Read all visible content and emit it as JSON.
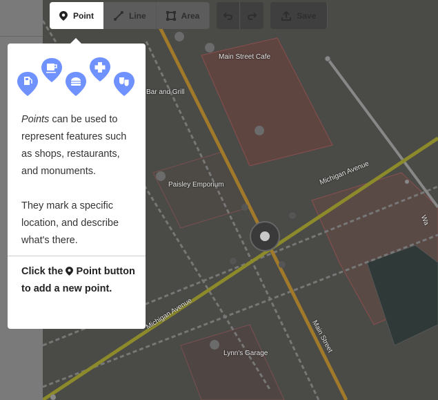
{
  "toolbar": {
    "point_label": "Point",
    "line_label": "Line",
    "area_label": "Area",
    "save_label": "Save",
    "icons": [
      "point-pin-icon",
      "line-icon",
      "area-icon",
      "undo-icon",
      "redo-icon",
      "upload-icon"
    ]
  },
  "map": {
    "labels": {
      "main_street_cafe": "Main Street Cafe",
      "bar_and_grill": "Bar and Grill",
      "paisley_emporium": "Paisley Emporium",
      "michigan_avenue_upper": "Michigan Avenue",
      "michigan_avenue_lower": "Michigan Avenue",
      "main_street": "Main Street",
      "lynns_garage": "Lynn's Garage",
      "partial_right": "Wa"
    }
  },
  "panel": {
    "icons": [
      "fuel-icon",
      "cafe-icon",
      "fast-food-icon",
      "hospital-icon",
      "theater-icon"
    ],
    "emphasis": "Points",
    "text1_rest": " can be used to represent features such as shops, restaurants, and monuments.",
    "text2": "They mark a specific location, and describe what's there.",
    "footer_pre": "Click the",
    "footer_btn": "Point",
    "footer_post": "button to add a new point."
  },
  "colors": {
    "accent_marker": "#7092ff",
    "main_road": "#c8a24a",
    "panel_bg": "#ffffff"
  }
}
